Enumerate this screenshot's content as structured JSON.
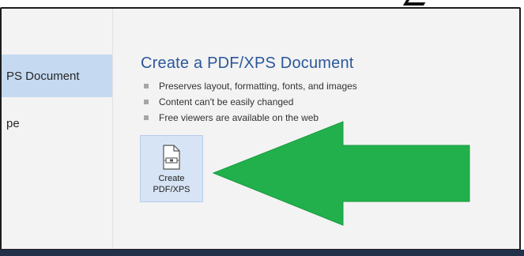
{
  "sidebar": {
    "items": [
      {
        "label": "PS Document",
        "selected": true
      },
      {
        "label": "pe",
        "selected": false
      }
    ]
  },
  "main": {
    "title": "Create a PDF/XPS Document",
    "bullets": [
      "Preserves layout, formatting, fonts, and images",
      "Content can't be easily changed",
      "Free viewers are available on the web"
    ],
    "create_button": {
      "line1": "Create",
      "line2": "PDF/XPS",
      "icon": "pdf-document-icon"
    }
  },
  "annotation": {
    "shape": "arrow-left",
    "color": "#21b04b"
  },
  "colors": {
    "accent": "#2b579a",
    "selected_bg": "#c5d9f1",
    "button_bg": "#d7e4f5"
  }
}
